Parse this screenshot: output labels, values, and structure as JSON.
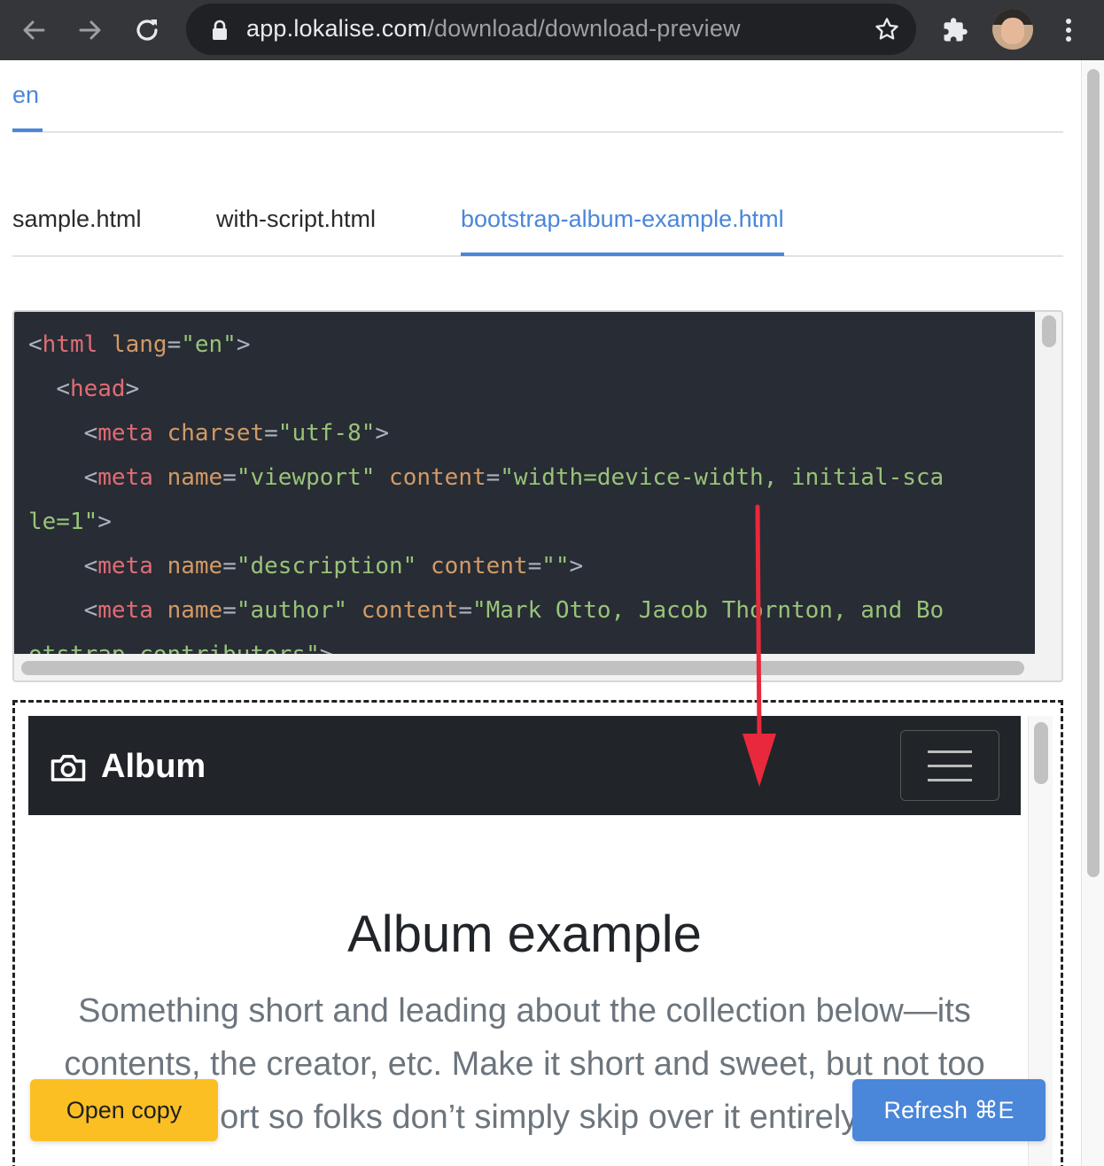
{
  "browser": {
    "url_host": "app.lokalise.com",
    "url_path": "/download/download-preview",
    "icons": [
      "back-icon",
      "forward-icon",
      "reload-icon",
      "lock-icon",
      "star-icon",
      "extensions-icon",
      "avatar",
      "more-icon"
    ]
  },
  "language_tabs": [
    {
      "label": "en",
      "active": true
    }
  ],
  "file_tabs": [
    {
      "label": "sample.html",
      "active": false
    },
    {
      "label": "with-script.html",
      "active": false
    },
    {
      "label": "bootstrap-album-example.html",
      "active": true
    }
  ],
  "code": {
    "lines": [
      {
        "indent": "",
        "tag": "html",
        "attrs": [
          {
            "name": "lang",
            "value": "\"en\""
          }
        ],
        "close": ">"
      },
      {
        "indent": "  ",
        "tag": "head",
        "attrs": [],
        "close": ">"
      },
      {
        "indent": "    ",
        "tag": "meta",
        "attrs": [
          {
            "name": "charset",
            "value": "\"utf-8\""
          }
        ],
        "close": ">"
      },
      {
        "indent": "    ",
        "tag": "meta",
        "attrs": [
          {
            "name": "name",
            "value": "\"viewport\""
          },
          {
            "name": "content",
            "value": "\"width=device-width, initial-sca"
          }
        ],
        "close": ""
      },
      {
        "indent": "",
        "tag": "",
        "attrs": [],
        "raw_str": "le=1\"",
        "close": ">"
      },
      {
        "indent": "    ",
        "tag": "meta",
        "attrs": [
          {
            "name": "name",
            "value": "\"description\""
          },
          {
            "name": "content",
            "value": "\"\""
          }
        ],
        "close": ">"
      },
      {
        "indent": "    ",
        "tag": "meta",
        "attrs": [
          {
            "name": "name",
            "value": "\"author\""
          },
          {
            "name": "content",
            "value": "\"Mark Otto, Jacob Thornton, and Bo"
          }
        ],
        "close": ""
      },
      {
        "indent": "",
        "tag": "",
        "attrs": [],
        "raw_str": "otstrap contributors\"",
        "close": ">"
      }
    ]
  },
  "preview": {
    "brand": "Album",
    "heading": "Album example",
    "lead": "Something short and leading about the collection below—its contents, the creator, etc. Make it short and sweet, but not too short so folks don’t simply skip over it entirely."
  },
  "buttons": {
    "open_copy": "Open copy",
    "refresh": "Refresh ⌘E"
  },
  "colors": {
    "accent": "#4a86d9",
    "open_copy_bg": "#fbbf24",
    "code_bg": "#282c34",
    "annotation_arrow": "#e8293b"
  }
}
